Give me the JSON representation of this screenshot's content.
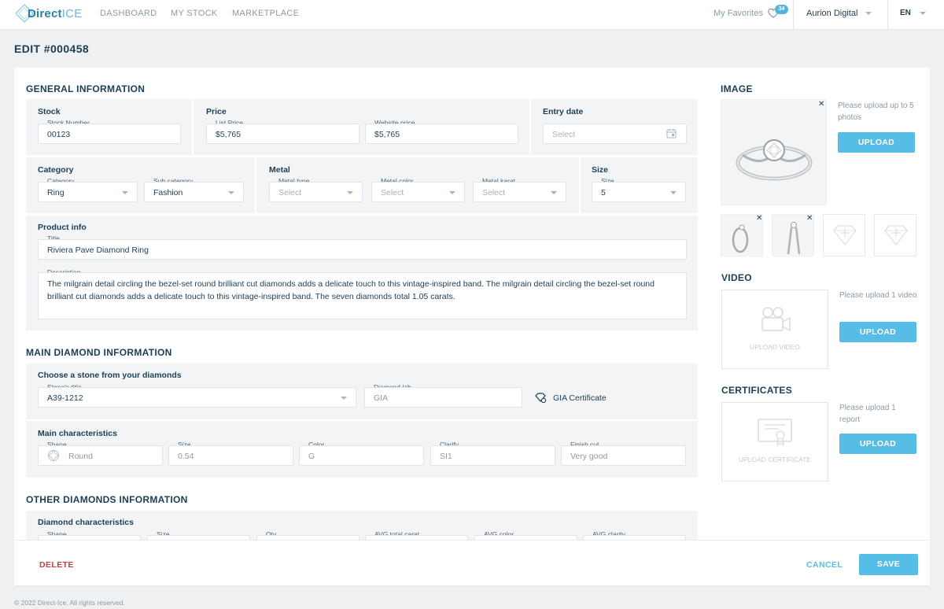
{
  "app": {
    "logo_direct": "Direct",
    "logo_ice": "ICE",
    "nav": [
      "DASHBOARD",
      "MY STOCK",
      "MARKETPLACE"
    ],
    "favorites_label": "My Favorites",
    "favorites_count": "34",
    "account": "Aurion Digital",
    "language": "EN"
  },
  "page_title": "EDIT #000458",
  "general": {
    "section_title": "GENERAL INFORMATION",
    "stock": {
      "title": "Stock",
      "stock_number_label": "Stock Number",
      "stock_number": "00123"
    },
    "price": {
      "title": "Price",
      "list_price_label": "List Price",
      "list_price": "$5,765",
      "website_price_label": "Website price",
      "website_price": "$5,765"
    },
    "entry": {
      "title": "Entry date",
      "placeholder": "Select"
    },
    "category": {
      "title": "Category",
      "category_label": "Category",
      "category": "Ring",
      "sub_label": "Sub category",
      "sub": "Fashion"
    },
    "metal": {
      "title": "Metal",
      "type_label": "Metal type",
      "type": "Select",
      "color_label": "Metal color",
      "color": "Select",
      "karat_label": "Metal karat",
      "karat": "Select"
    },
    "size": {
      "title": "Size",
      "size_label": "Size",
      "size": "5"
    },
    "product": {
      "title": "Product info",
      "title_label": "Title",
      "title_value": "Riviera Pave Diamond Ring",
      "desc_label": "Description",
      "desc": "The milgrain detail circling the bezel-set round brilliant cut diamonds adds a delicate touch to this vintage-inspired band. The milgrain detail circling the bezel-set round brilliant cut diamonds adds a delicate touch to this vintage-inspired band. The seven diamonds total 1.05 carats."
    }
  },
  "main_diamond": {
    "section_title": "MAIN DIAMOND INFORMATION",
    "choose_title": "Choose a stone from your diamonds",
    "stone_label": "Stone's title",
    "stone": "A39-1212",
    "lab_label": "Diamond lab",
    "lab": "GIA",
    "certificate_link": "GIA Certificate",
    "chars_title": "Main characteristics",
    "shape_label": "Shape",
    "shape": "Round",
    "size_label": "Size",
    "size": "0.54",
    "color_label": "Color",
    "color": "G",
    "clarity_label": "Clarify",
    "clarity": "SI1",
    "finish_label": "Finish cut",
    "finish": "Very good"
  },
  "other_diamonds": {
    "section_title": "OTHER DIAMONDS INFORMATION",
    "chars_title": "Diamond characteristics",
    "labels": [
      "Shape",
      "Size",
      "Qty",
      "AVG total carat",
      "AVG color",
      "AVG clarity"
    ]
  },
  "media": {
    "image_title": "IMAGE",
    "image_note": "Please upload up to 5 photos",
    "upload_label": "UPLOAD",
    "video_title": "VIDEO",
    "video_note": "Please upload 1 video",
    "video_drop": "UPLOAD VIDEO",
    "cert_title": "CERTIFICATES",
    "cert_note": "Please upload 1 report",
    "cert_drop": "UPLOAD CERTIFICATE",
    "close_glyph": "✕"
  },
  "actions": {
    "delete": "DELETE",
    "cancel": "CANCEL",
    "save": "SAVE"
  },
  "footer": {
    "copyright": "© 2022 Direct-Ice. All rights reserved."
  },
  "colors": {
    "accent": "#55bde6",
    "danger": "#c2413b",
    "text": "#1c3e55",
    "panel": "#f2f4f6"
  }
}
